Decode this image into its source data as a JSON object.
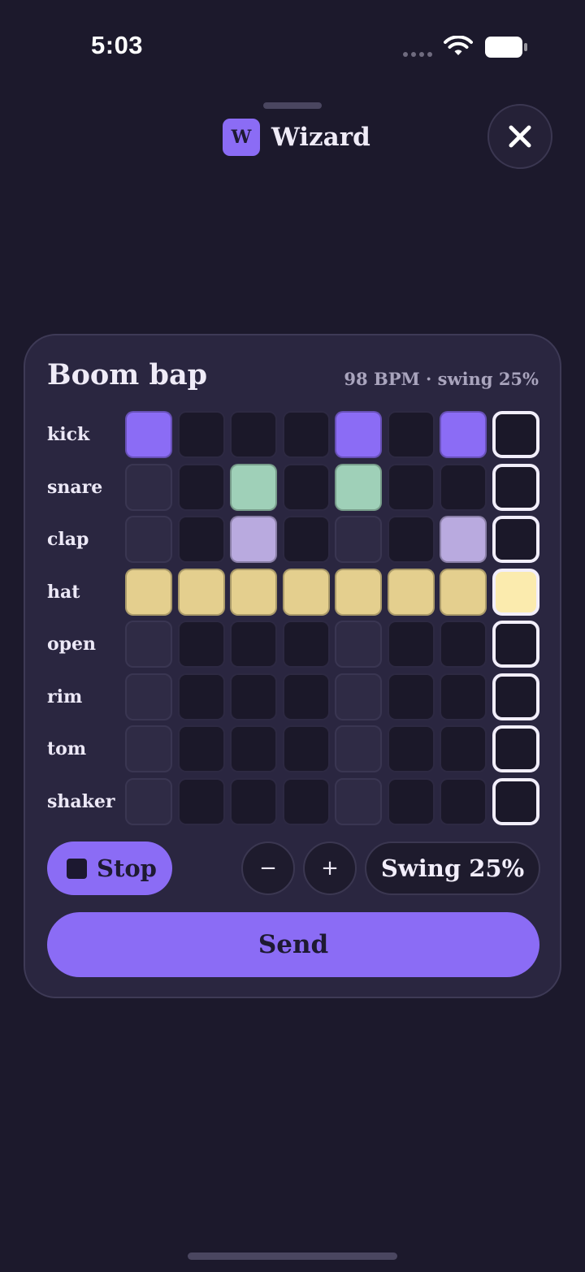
{
  "status": {
    "time": "5:03"
  },
  "header": {
    "badge": "W",
    "title": "Wizard"
  },
  "card": {
    "title": "Boom bap",
    "meta": "98 BPM · swing 25%"
  },
  "colors": {
    "accent": "#8b6cf5",
    "kick": "#8b6cf5",
    "snare": "#9fd0b8",
    "clap": "#b9aadf",
    "hat": "#e4cf8e",
    "hat_current": "#fbebae"
  },
  "sequencer": {
    "current_step": 8,
    "tracks": [
      {
        "name": "kick",
        "steps": [
          1,
          0,
          0,
          0,
          1,
          0,
          1,
          0
        ]
      },
      {
        "name": "snare",
        "steps": [
          0,
          0,
          1,
          0,
          1,
          0,
          0,
          0
        ]
      },
      {
        "name": "clap",
        "steps": [
          0,
          0,
          1,
          0,
          0,
          0,
          1,
          0
        ]
      },
      {
        "name": "hat",
        "steps": [
          1,
          1,
          1,
          1,
          1,
          1,
          1,
          1
        ]
      },
      {
        "name": "open",
        "steps": [
          0,
          0,
          0,
          0,
          0,
          0,
          0,
          0
        ]
      },
      {
        "name": "rim",
        "steps": [
          0,
          0,
          0,
          0,
          0,
          0,
          0,
          0
        ]
      },
      {
        "name": "tom",
        "steps": [
          0,
          0,
          0,
          0,
          0,
          0,
          0,
          0
        ]
      },
      {
        "name": "shaker",
        "steps": [
          0,
          0,
          0,
          0,
          0,
          0,
          0,
          0
        ]
      }
    ]
  },
  "controls": {
    "stop_label": "Stop",
    "decrease_label": "−",
    "increase_label": "+",
    "swing_label": "Swing 25%",
    "send_label": "Send"
  }
}
